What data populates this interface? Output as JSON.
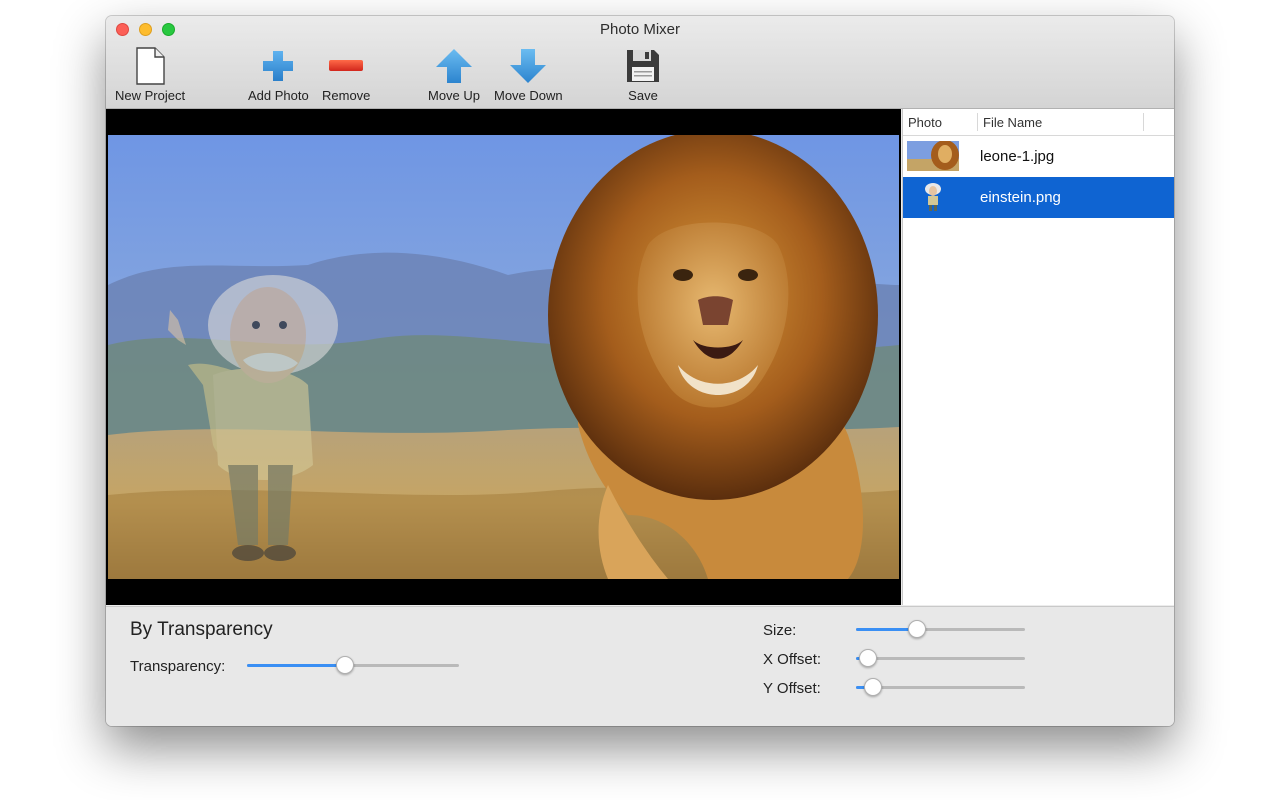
{
  "window": {
    "title": "Photo Mixer"
  },
  "toolbar": {
    "new_project": "New Project",
    "add_photo": "Add Photo",
    "remove": "Remove",
    "move_up": "Move Up",
    "move_down": "Move Down",
    "save": "Save"
  },
  "photo_list": {
    "columns": [
      "Photo",
      "File Name"
    ],
    "rows": [
      {
        "file_name": "leone-1.jpg",
        "selected": false
      },
      {
        "file_name": "einstein.png",
        "selected": true
      }
    ]
  },
  "controls": {
    "mode_title": "By Transparency",
    "transparency": {
      "label": "Transparency:",
      "value": 0.46
    },
    "size": {
      "label": "Size:",
      "value": 0.36
    },
    "x_offset": {
      "label": "X Offset:",
      "value": 0.07
    },
    "y_offset": {
      "label": "Y Offset:",
      "value": 0.1
    }
  },
  "colors": {
    "accent": "#3a8ff4",
    "selection": "#0f64d2",
    "close": "#fc5f57",
    "minimize": "#fdbc2e",
    "maximize": "#28c840"
  }
}
